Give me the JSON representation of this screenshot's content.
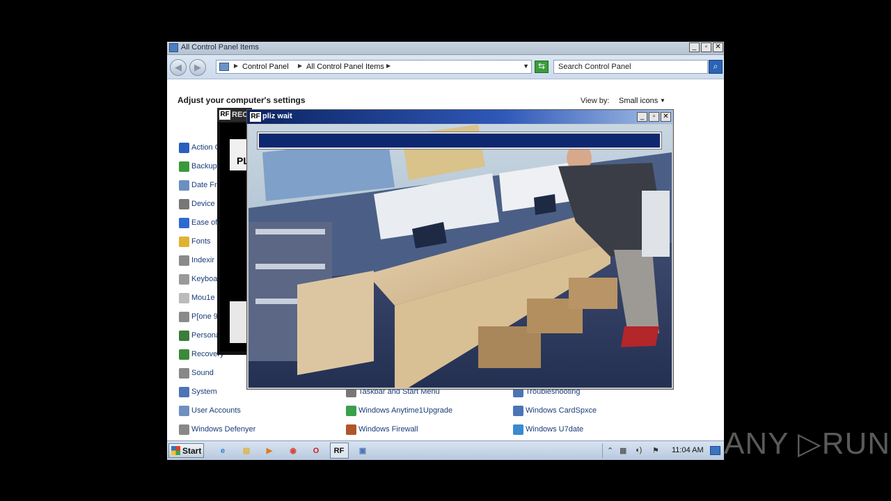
{
  "explorer": {
    "title": "All Control Panel Items",
    "window_buttons": [
      "_",
      "▫",
      "✕"
    ],
    "address": {
      "crumbs": [
        "Control Panel",
        "All Control Panel Items"
      ]
    },
    "search_placeholder": "Search Control Panel",
    "heading": "Adjust your computer's settings",
    "view_by_label": "View by:",
    "view_by_value": "Small icons",
    "items_col1": [
      {
        "label": "Action C",
        "icon": "flag-icon",
        "color": "#2b5fbf"
      },
      {
        "label": "Backup",
        "icon": "backup-icon",
        "color": "#3a9a3a"
      },
      {
        "label": "Date Fr",
        "icon": "clock-icon",
        "color": "#6a8fc0"
      },
      {
        "label": "Device",
        "icon": "printer-icon",
        "color": "#777777"
      },
      {
        "label": "Ease of",
        "icon": "ease-icon",
        "color": "#2e6bd0"
      },
      {
        "label": "Fonts",
        "icon": "folder-icon",
        "color": "#e0b232"
      },
      {
        "label": "Indexir",
        "icon": "index-icon",
        "color": "#8a8a8a"
      },
      {
        "label": "Keyboa",
        "icon": "keyboard-icon",
        "color": "#9a9a9a"
      },
      {
        "label": "Mou1e",
        "icon": "mouse-icon",
        "color": "#bbbbbb"
      },
      {
        "label": "P[one 9",
        "icon": "phone-icon",
        "color": "#8a8a8a"
      },
      {
        "label": "Persona",
        "icon": "personalize-icon",
        "color": "#3b7d3b"
      },
      {
        "label": "Recovery",
        "icon": "recovery-icon",
        "color": "#3a8a3a"
      },
      {
        "label": "Sound",
        "icon": "sound-icon",
        "color": "#888888"
      },
      {
        "label": "System",
        "icon": "system-icon",
        "color": "#4d74b5"
      },
      {
        "label": "User Accounts",
        "icon": "users-icon",
        "color": "#6f8fbf"
      },
      {
        "label": "Windows Defenyer",
        "icon": "defender-icon",
        "color": "#888888"
      }
    ],
    "items_col2": [
      {
        "label": "Taskbar and Start Menu",
        "icon": "taskbar-icon",
        "color": "#777777"
      },
      {
        "label": "Windows Anytime1Upgrade",
        "icon": "upgrade-icon",
        "color": "#3aa04a"
      },
      {
        "label": "Windows Firewall",
        "icon": "firewall-icon",
        "color": "#b0562a"
      }
    ],
    "items_col3": [
      {
        "label": "Troubleshooting",
        "icon": "troubleshoot-icon",
        "color": "#4d74b5"
      },
      {
        "label": "Windows CardSpxce",
        "icon": "cardspace-icon",
        "color": "#4d74b5"
      },
      {
        "label": "Windows U7date",
        "icon": "update-icon",
        "color": "#3a8ad0"
      }
    ]
  },
  "rf_window": {
    "logo": "RF",
    "title": "REC",
    "pane_text": "PL"
  },
  "popup": {
    "logo": "RF",
    "title": "pliz wait",
    "window_buttons": [
      "_",
      "▫",
      "✕"
    ],
    "progress": 1.0,
    "progress_color": "#0d2870"
  },
  "taskbar": {
    "start_label": "Start",
    "apps": [
      {
        "icon": "ie-icon",
        "glyph": "e",
        "color": "#2a7fd4"
      },
      {
        "icon": "explorer-icon",
        "glyph": "▤",
        "color": "#e0b232"
      },
      {
        "icon": "media-player-icon",
        "glyph": "▶",
        "color": "#e07a1e"
      },
      {
        "icon": "chrome-icon",
        "glyph": "◉",
        "color": "#d94436"
      },
      {
        "icon": "opera-icon",
        "glyph": "O",
        "color": "#d1191f"
      },
      {
        "icon": "rf-app-icon",
        "glyph": "RF",
        "color": "#111111"
      },
      {
        "icon": "control-panel-icon",
        "glyph": "▣",
        "color": "#4d74b5"
      }
    ],
    "clock": "11:04 AM"
  },
  "watermark": "ANY ▷RUN"
}
